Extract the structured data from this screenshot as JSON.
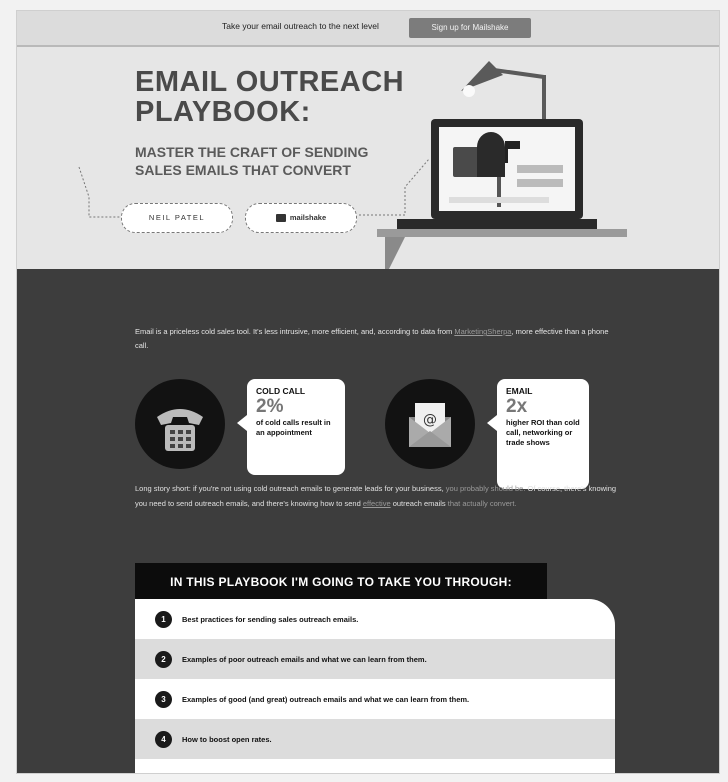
{
  "topbar": {
    "text": "Take your email outreach to the next level",
    "button": "Sign up for Mailshake"
  },
  "hero": {
    "title_line1": "EMAIL OUTREACH",
    "title_line2": "PLAYBOOK:",
    "subtitle_line1": "MASTER THE CRAFT OF SENDING",
    "subtitle_line2": "SALES EMAILS THAT CONVERT",
    "logo1": "NEIL PATEL",
    "logo2": "mailshake"
  },
  "intro": {
    "text_before": "Email is a priceless cold sales tool. It's less intrusive, more efficient, and, according to data from ",
    "link": "MarketingSherpa",
    "text_after": ", more effective than a phone call."
  },
  "stats": [
    {
      "label": "COLD CALL",
      "value": "2%",
      "desc": "of cold calls result in an appointment"
    },
    {
      "label": "EMAIL",
      "value": "2x",
      "desc": "higher ROI than cold call, networking or trade shows"
    }
  ],
  "story": {
    "p1": "Long story short: if you're not using cold outreach emails to generate leads for your business, ",
    "p1_muted": "you probably should be.",
    "p2": " Of course, there's knowing you need to send outreach emails, and there's knowing how to send ",
    "p3_link": "effective",
    "p3": " outreach emails ",
    "p3_muted": "that actually convert."
  },
  "playbook": {
    "header": "IN THIS PLAYBOOK I'M GOING TO TAKE YOU THROUGH:",
    "items": [
      {
        "num": "1",
        "text": "Best practices for sending sales outreach emails."
      },
      {
        "num": "2",
        "text": "Examples of poor outreach emails and what we can learn from them."
      },
      {
        "num": "3",
        "text": "Examples of good (and great) outreach emails and what we can learn from them."
      },
      {
        "num": "4",
        "text": "How to boost open rates."
      }
    ]
  },
  "colors": {
    "dark_bg": "#3d3d3d",
    "hero_bg": "#e6e6e6",
    "button_bg": "#7c7c7c"
  }
}
